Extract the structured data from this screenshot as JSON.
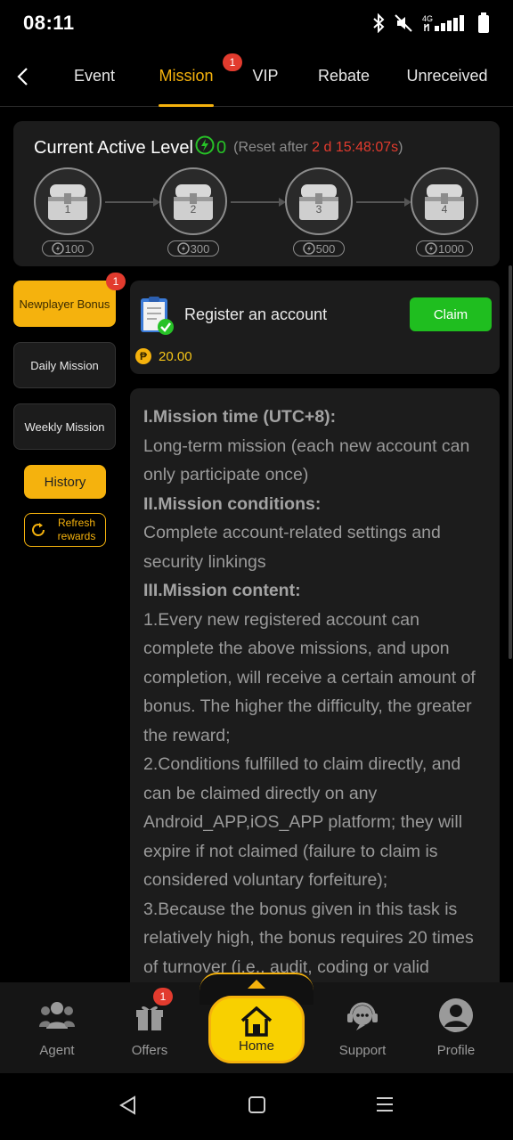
{
  "status_bar": {
    "time": "08:11",
    "icons": [
      "bluetooth-icon",
      "mute-icon",
      "signal-4g-icon",
      "battery-icon"
    ]
  },
  "top_nav": {
    "tabs": [
      {
        "label": "Event"
      },
      {
        "label": "Mission",
        "active": true,
        "badge": "1"
      },
      {
        "label": "VIP"
      },
      {
        "label": "Rebate"
      },
      {
        "label": "Unreceived"
      }
    ]
  },
  "level": {
    "title": "Current Active Level",
    "value": "0",
    "reset_prefix": "(Reset after ",
    "reset_time": "2 d 15:48:07s",
    "reset_suffix": ")",
    "chests": [
      {
        "number": "1",
        "points": "100"
      },
      {
        "number": "2",
        "points": "300"
      },
      {
        "number": "3",
        "points": "500"
      },
      {
        "number": "4",
        "points": "1000"
      }
    ]
  },
  "side_menu": {
    "newplayer": {
      "label": "Newplayer Bonus",
      "badge": "1"
    },
    "daily": {
      "label": "Daily Mission"
    },
    "weekly": {
      "label": "Weekly Mission"
    },
    "history": "History",
    "refresh": "Refresh rewards"
  },
  "task": {
    "name": "Register an account",
    "claim": "Claim",
    "reward": "20.00"
  },
  "description": {
    "h1": "I.Mission time (UTC+8):",
    "p1": "Long-term mission (each new account can only participate once)",
    "h2": "II.Mission conditions:",
    "p2": "Complete account-related settings and security linkings",
    "h3": "III.Mission content:",
    "p3": "1.Every new registered account can complete the above missions, and upon completion, will receive a certain amount of bonus. The higher the difficulty, the greater the reward;",
    "p4": "2.Conditions fulfilled to claim directly, and can be claimed directly on any Android_APP,iOS_APP platform; they will expire if not claimed (failure to claim is considered voluntary forfeiture);",
    "p5": "3.Because the bonus given in this task is relatively high, the bonus requires 20 times of turnover (i.e., audit, coding or valid"
  },
  "bottom_nav": {
    "agent": "Agent",
    "offers": "Offers",
    "offers_badge": "1",
    "home": "Home",
    "support": "Support",
    "profile": "Profile"
  },
  "colors": {
    "accent": "#f5b20d",
    "claim_green": "#1fbe1f",
    "badge_red": "#e23b2e",
    "level_green": "#27c227"
  }
}
